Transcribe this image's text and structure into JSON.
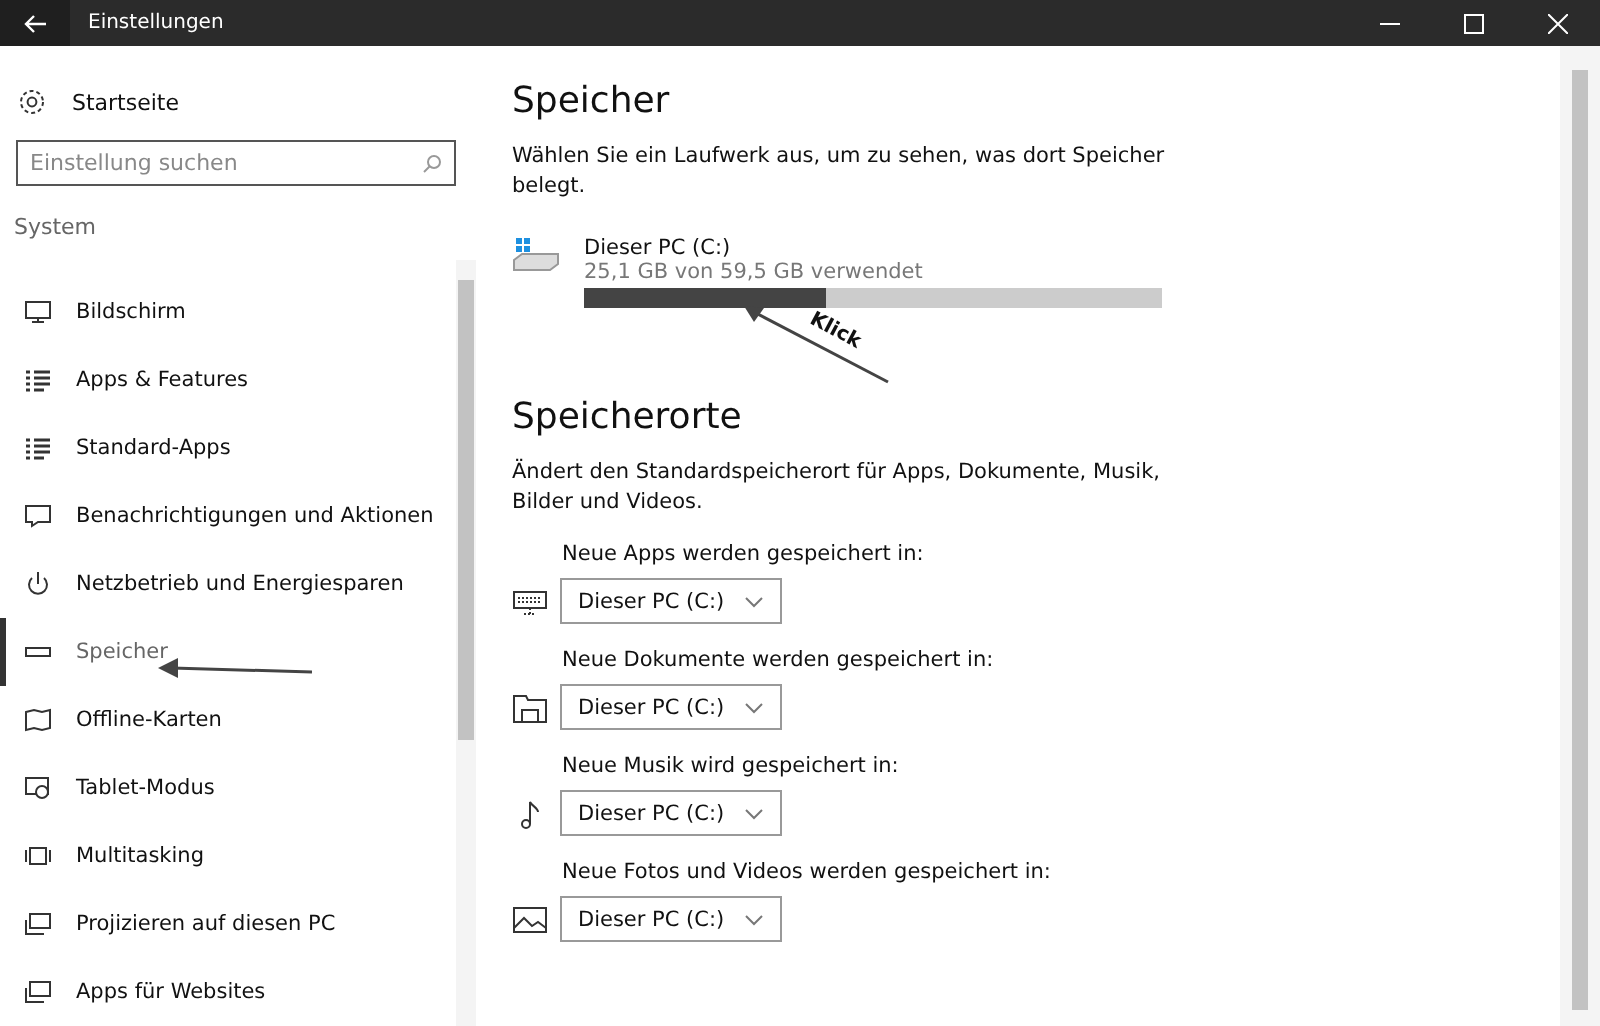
{
  "window": {
    "title": "Einstellungen"
  },
  "sidebar": {
    "home": "Startseite",
    "search": {
      "placeholder": "Einstellung suchen"
    },
    "section": "System",
    "items": [
      {
        "label": "Bildschirm",
        "selected": false
      },
      {
        "label": "Apps & Features",
        "selected": false
      },
      {
        "label": "Standard-Apps",
        "selected": false
      },
      {
        "label": "Benachrichtigungen und Aktionen",
        "selected": false
      },
      {
        "label": "Netzbetrieb und Energiesparen",
        "selected": false
      },
      {
        "label": "Speicher",
        "selected": true
      },
      {
        "label": "Offline-Karten",
        "selected": false
      },
      {
        "label": "Tablet-Modus",
        "selected": false
      },
      {
        "label": "Multitasking",
        "selected": false
      },
      {
        "label": "Projizieren auf diesen PC",
        "selected": false
      },
      {
        "label": "Apps für Websites",
        "selected": false
      }
    ]
  },
  "main": {
    "title": "Speicher",
    "description": "Wählen Sie ein Laufwerk aus, um zu sehen, was dort Speicher belegt.",
    "drive": {
      "name": "Dieser PC (C:)",
      "usage": "25,1 GB von 59,5 GB verwendet",
      "level": 0.42
    },
    "annotation": "Klick",
    "locations_title": "Speicherorte",
    "locations_description": "Ändert den Standardspeicherort für Apps, Dokumente, Musik, Bilder und Videos.",
    "locations": [
      {
        "label": "Neue Apps werden gespeichert in:",
        "value": "Dieser PC (C:)"
      },
      {
        "label": "Neue Dokumente werden gespeichert in:",
        "value": "Dieser PC (C:)"
      },
      {
        "label": "Neue Musik wird gespeichert in:",
        "value": "Dieser PC (C:)"
      },
      {
        "label": "Neue Fotos und Videos werden gespeichert in:",
        "value": "Dieser PC (C:)"
      }
    ]
  }
}
